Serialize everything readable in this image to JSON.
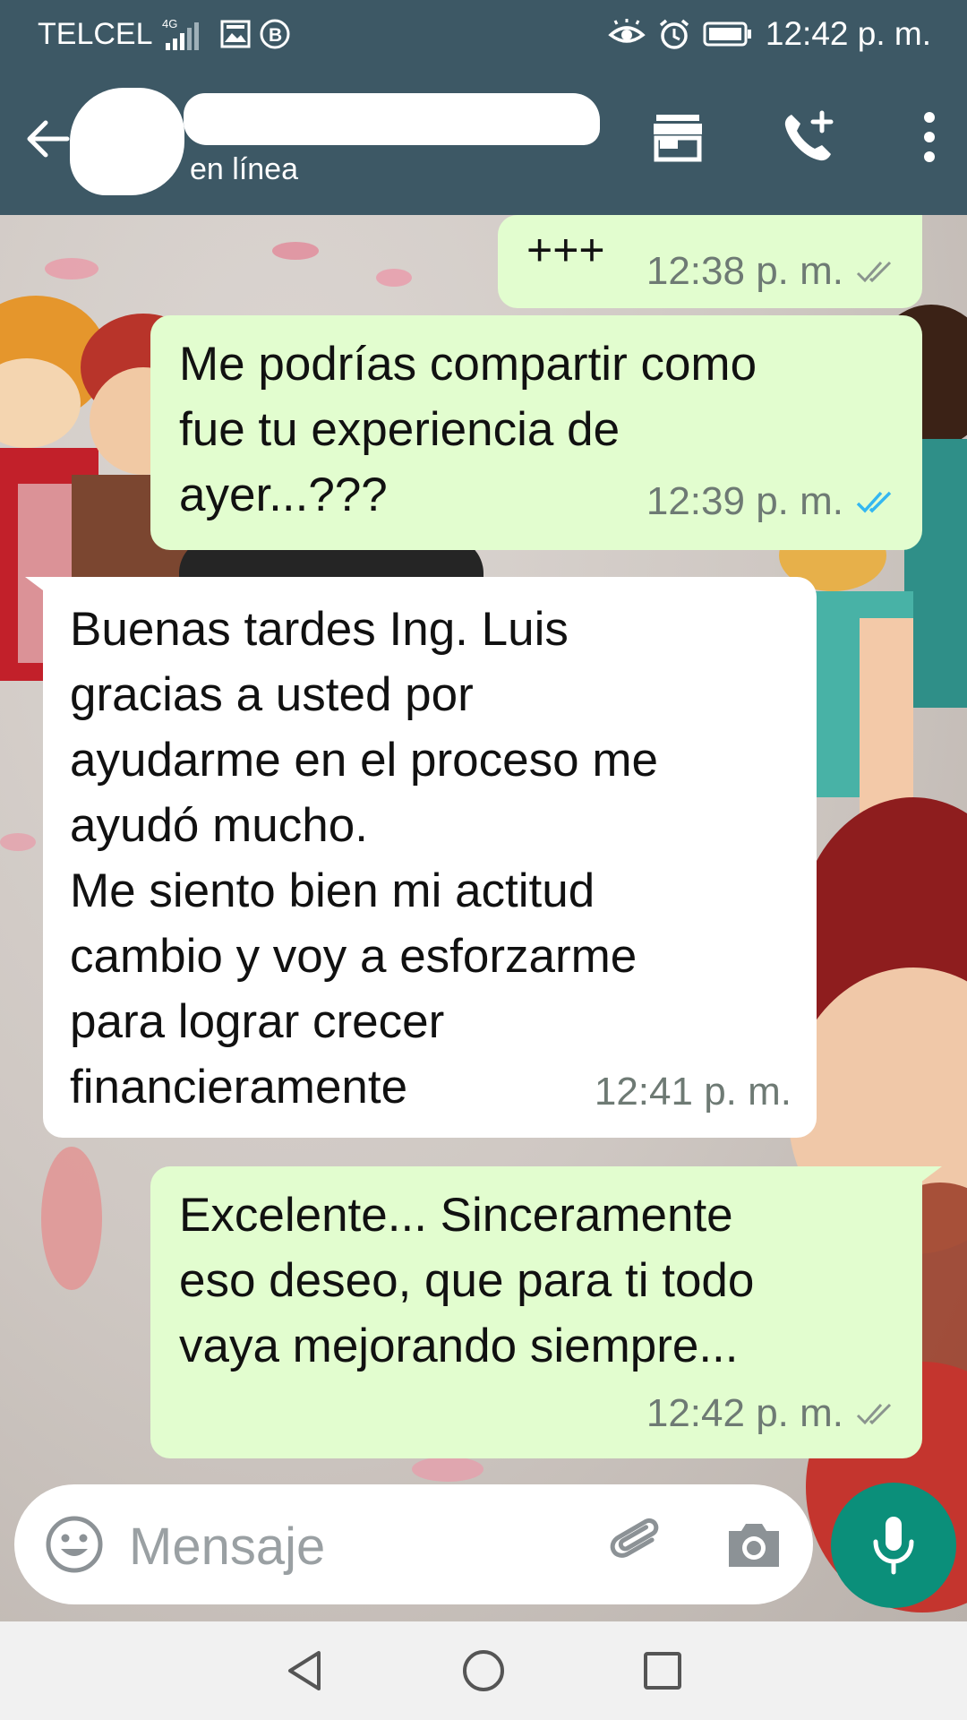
{
  "status_bar": {
    "carrier": "TELCEL",
    "network": "4G",
    "time": "12:42 p. m."
  },
  "header": {
    "contact_status": "en línea",
    "icons": [
      "back-arrow-icon",
      "store-icon",
      "add-call-icon",
      "more-vert-icon"
    ]
  },
  "messages": [
    {
      "direction": "out",
      "text": "+++",
      "time": "12:38 p. m.",
      "ticks": "read-gray"
    },
    {
      "direction": "out",
      "text": "Me podrías compartir como\nfue tu experiencia de\nayer...???",
      "time": "12:39 p. m.",
      "ticks": "read-blue"
    },
    {
      "direction": "in",
      "text": "Buenas tardes Ing. Luis\ngracias a usted por\nayudarme   en el proceso me\nayudó mucho.\nMe siento bien mi actitud\ncambio y voy a esforzarme\npara lograr crecer\nfinancieramente",
      "time": "12:41 p. m."
    },
    {
      "direction": "out",
      "text": "Excelente... Sinceramente\neso deseo, que para ti todo\nvaya mejorando siempre...",
      "time": "12:42 p. m.",
      "ticks": "read-gray"
    }
  ],
  "input": {
    "placeholder": "Mensaje",
    "icons": [
      "emoji-icon",
      "attach-icon",
      "camera-icon",
      "mic-icon"
    ]
  },
  "colors": {
    "header_bg": "#3d5865",
    "outgoing_bubble": "#e2fdcf",
    "incoming_bubble": "#ffffff",
    "mic_button": "#0b8f7a",
    "read_tick_blue": "#34b7f1",
    "tick_gray": "#8a948e"
  },
  "navigation": {
    "icons": [
      "back-triangle-icon",
      "home-circle-icon",
      "recents-square-icon"
    ]
  }
}
